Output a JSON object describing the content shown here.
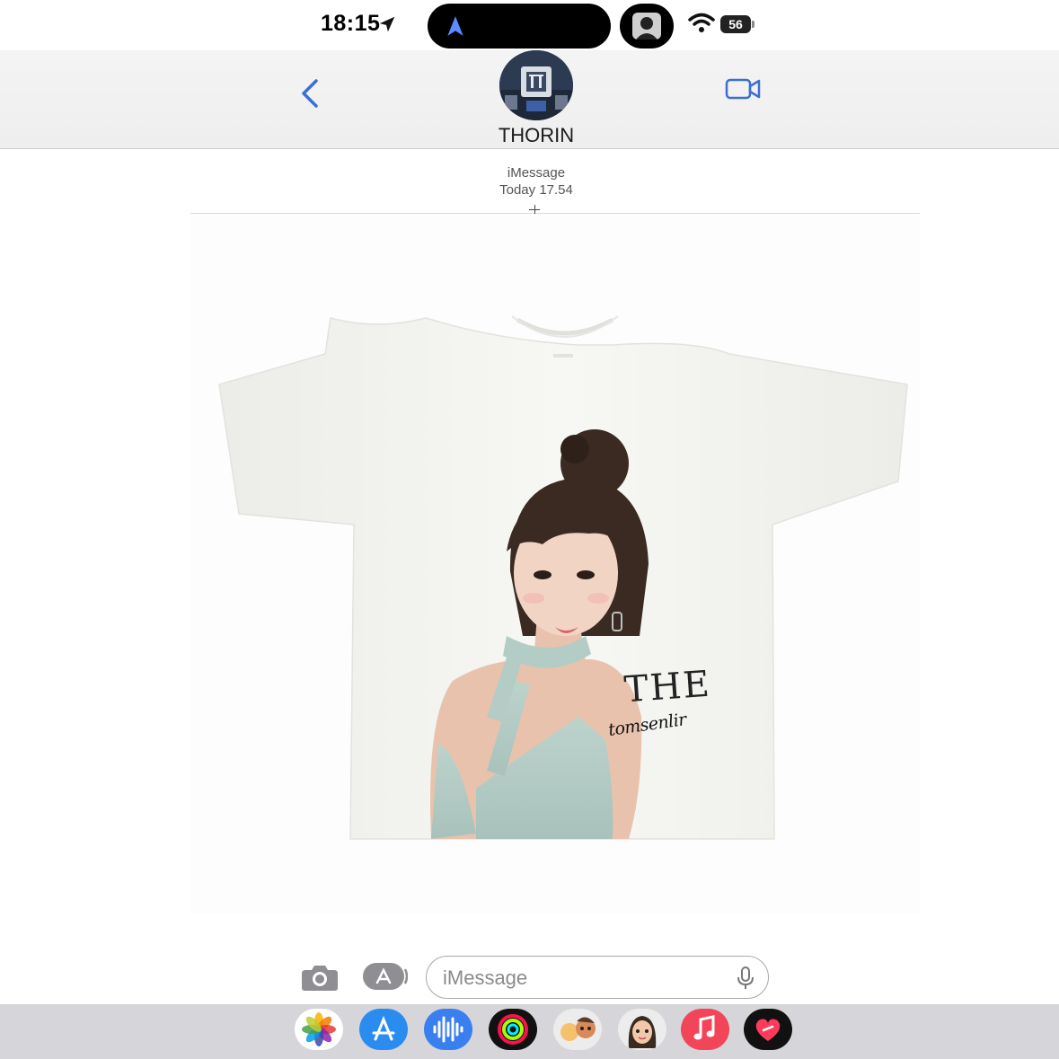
{
  "status_bar": {
    "time": "18:15",
    "battery": "56",
    "icons": [
      "location-arrow-icon",
      "navigation-icon",
      "live-activity-icon",
      "wifi-icon",
      "battery-icon"
    ]
  },
  "header": {
    "back_icon": "chevron-left-icon",
    "contact_name": "THORIN",
    "video_icon": "video-camera-icon"
  },
  "message": {
    "service": "iMessage",
    "timestamp": "Today 17.54",
    "attachment": {
      "kind": "t-shirt-product-photo",
      "print_title": "THE",
      "print_subtitle": "tomsenlir"
    }
  },
  "composer": {
    "camera_icon": "camera-icon",
    "apps_icon": "app-store-icon",
    "placeholder": "iMessage",
    "mic_icon": "microphone-icon"
  },
  "app_drawer": {
    "apps": [
      "photos",
      "app-store",
      "audio-message",
      "fitness",
      "memoji-stickers",
      "memoji",
      "music",
      "digital-touch"
    ]
  },
  "colors": {
    "accent": "#3b6fd4",
    "drawer_bg": "#d6d6da",
    "music_red": "#f2455a",
    "header_bg": "#f0f0f0"
  }
}
